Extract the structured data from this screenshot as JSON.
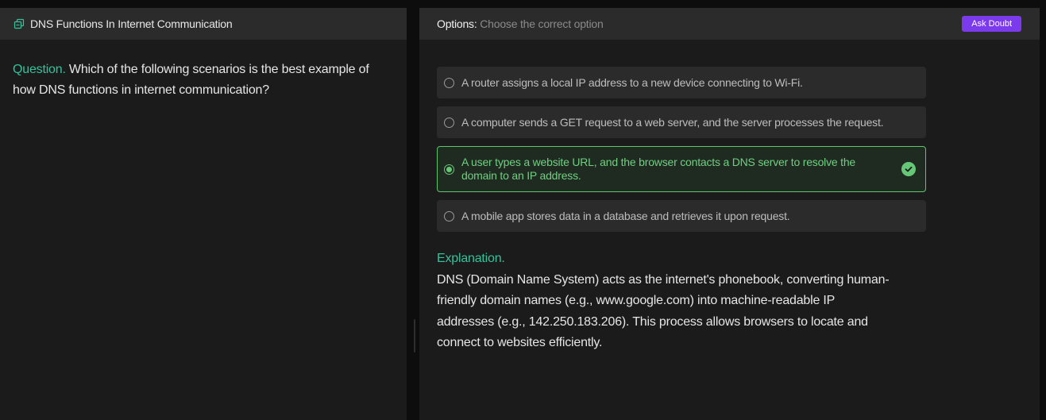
{
  "left_panel": {
    "title": "DNS Functions In Internet Communication",
    "icon": "copy-icon",
    "question_label": "Question.",
    "question_text": " Which of the following scenarios is the best example of how DNS functions in internet communication?"
  },
  "right_panel": {
    "options_label": "Options:",
    "options_hint": " Choose the correct option",
    "ask_button": "Ask Doubt",
    "options": [
      {
        "text": "A router assigns a local IP address to a new device connecting to Wi-Fi.",
        "selected": false
      },
      {
        "text": "A computer sends a GET request to a web server, and the server processes the request.",
        "selected": false
      },
      {
        "text": "A user types a website URL, and the browser contacts a DNS server to resolve the domain to an IP address.",
        "selected": true,
        "correct": true
      },
      {
        "text": "A mobile app stores data in a database and retrieves it upon request.",
        "selected": false
      }
    ],
    "explanation_label": "Explanation.",
    "explanation_text": "DNS (Domain Name System) acts as the internet's phonebook, converting human-friendly domain names (e.g., www.google.com) into machine-readable IP addresses (e.g., 142.250.183.206). This process allows browsers to locate and connect to websites efficiently."
  },
  "colors": {
    "accent_teal": "#34c29a",
    "correct_green": "#66c877",
    "button_purple": "#7c3aed",
    "panel_bg": "#1b1b1b",
    "header_bg": "#2b2b2b"
  }
}
